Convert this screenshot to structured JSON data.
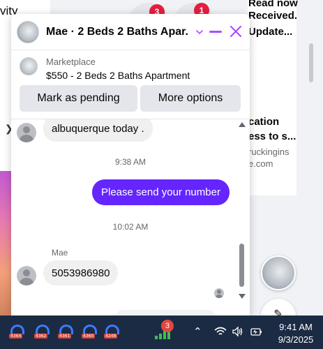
{
  "background": {
    "left_heading": "vity",
    "right_lines": [
      "Read now",
      "Received.",
      "Update...",
      "cation",
      "ess to s...",
      "ruckingins",
      "e.com"
    ],
    "badges": [
      "3",
      "1"
    ]
  },
  "chat": {
    "title": "Mae · 2 Beds 2 Baths Apar...",
    "accent_color": "#b04cff",
    "listing": {
      "source": "Marketplace",
      "title": "$550 - 2 Beds 2 Baths Apartment"
    },
    "actions": {
      "pending_label": "Mark as pending",
      "more_label": "More options"
    },
    "messages": {
      "incoming_1": "albuquerque today  .",
      "timestamp_1": "9:38 AM",
      "outgoing_1": "Please send your number",
      "timestamp_2": "10:02 AM",
      "sender_name": "Mae",
      "incoming_2": "5053986980"
    },
    "outgoing_color": "#6425ff"
  },
  "taskbar": {
    "apps": [
      "4364",
      "4362",
      "4361",
      "4360",
      "4248"
    ],
    "network_badge": "3",
    "time": "9:41 AM",
    "date": "9/3/2025"
  }
}
